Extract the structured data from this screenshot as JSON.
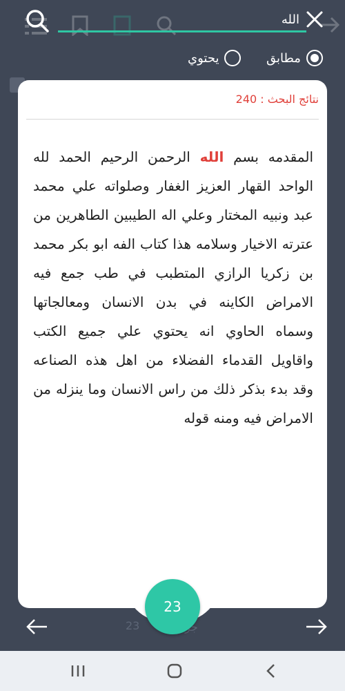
{
  "search": {
    "query": "الله"
  },
  "match_mode": {
    "exact_label": "مطابق",
    "contains_label": "يحتوي",
    "selected": "exact"
  },
  "results": {
    "count_label": "نتائج البحث : 240",
    "text_before": "المقدمه بسم ",
    "highlight": "الله",
    "text_after": " الرحمن الرحيم الحمد لله الواحد القهار العزيز الغفار وصلواته علي محمد عبد ونبيه المختار وعلي اله الطيبين الطاهرين من عترته الاخيار وسلامه هذا كتاب الفه ابو بكر محمد بن زكريا الرازي المتطبب في طب جمع فيه الامراض الكاينه في بدن الانسان ومعالجاتها وسماه الحاوي انه يحتوي علي جميع الكتب واقاويل القدماء الفضلاء من اهل هذه الصناعه وقد بدء بذكر ذلك من راس الانسان وما ينزله من الامراض فيه ومنه قوله"
  },
  "page": {
    "current": "23"
  },
  "background": {
    "page_number": "23",
    "part_label": "جز"
  },
  "icons": {
    "search": "search-icon",
    "clear": "close-icon",
    "prev": "arrow-left-icon",
    "next": "arrow-right-icon",
    "recents": "recents-icon",
    "home": "home-icon",
    "back": "back-icon"
  },
  "colors": {
    "accent": "#2ec7a6",
    "highlight": "#e0403a",
    "overlay_bg": "#3f4756"
  }
}
